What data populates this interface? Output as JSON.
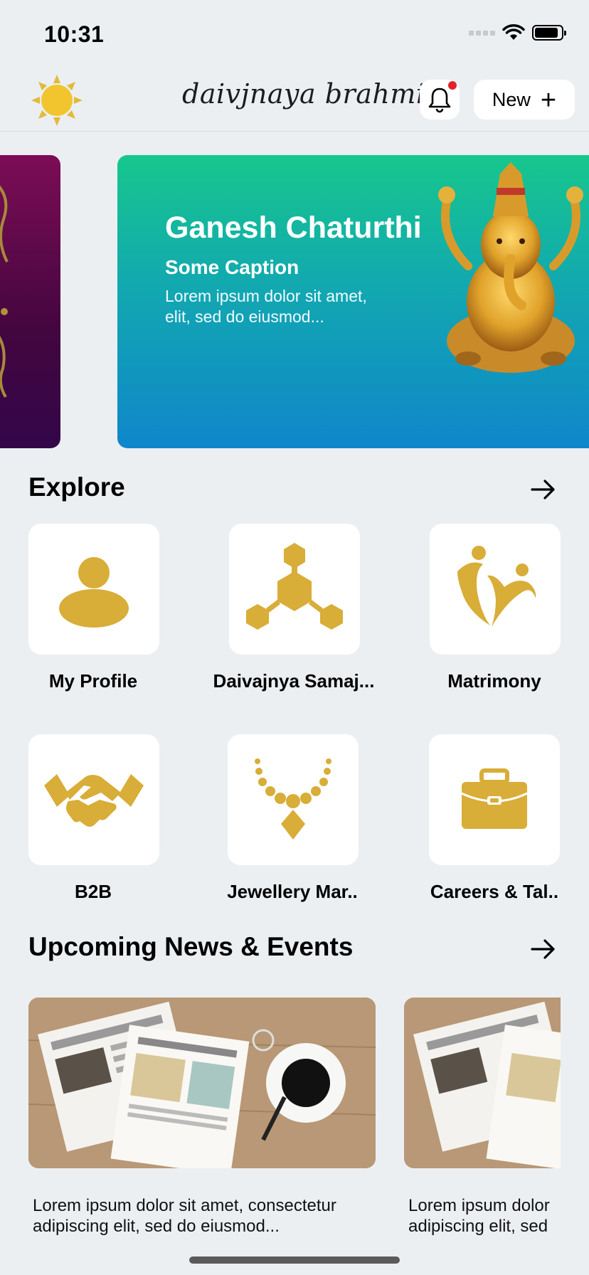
{
  "status_bar": {
    "time": "10:31",
    "battery_level": 0.9
  },
  "header": {
    "brand": "daivjnaya brahmin",
    "new_label": "New"
  },
  "banner": {
    "title": "Ganesh Chaturthi",
    "caption": "Some Caption",
    "text": "Lorem ipsum dolor sit amet,\n elit, sed do eiusmod..."
  },
  "explore": {
    "title": "Explore",
    "items": [
      {
        "label": "My Profile",
        "icon": "person-icon"
      },
      {
        "label": "Daivajnya Samaj...",
        "icon": "hexagon-network-icon"
      },
      {
        "label": "Matrimony",
        "icon": "heart-couple-icon"
      },
      {
        "label": "B2B",
        "icon": "handshake-icon"
      },
      {
        "label": "Jewellery Mar..",
        "icon": "necklace-icon"
      },
      {
        "label": "Careers & Tal..",
        "icon": "briefcase-icon"
      }
    ]
  },
  "news": {
    "title": "Upcoming News & Events",
    "items": [
      {
        "text": "Lorem ipsum dolor sit amet, consectetur\n adipiscing elit, sed do eiusmod..."
      },
      {
        "text": "Lorem ipsum dolor\n adipiscing elit, sed"
      }
    ]
  },
  "colors": {
    "accent_gold": "#d8ad38",
    "background": "#eceff2",
    "banner_top": "#17c78c",
    "banner_bottom": "#0f86cb"
  }
}
